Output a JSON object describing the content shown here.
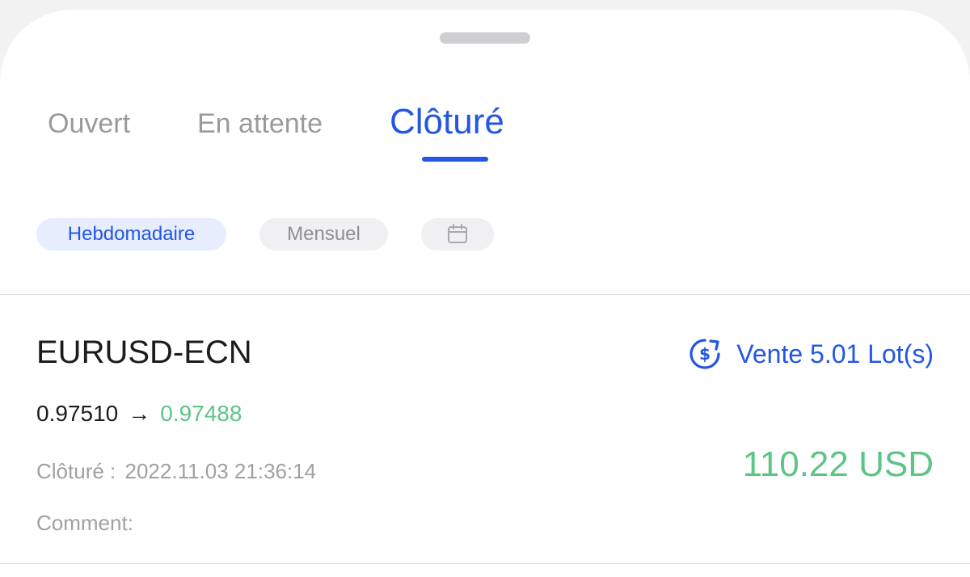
{
  "tabs": {
    "open": "Ouvert",
    "pending": "En attente",
    "closed": "Clôturé"
  },
  "filters": {
    "weekly": "Hebdomadaire",
    "monthly": "Mensuel",
    "calendar_icon": "calendar-icon"
  },
  "trade": {
    "symbol": "EURUSD-ECN",
    "order_icon": "currency-exchange-icon",
    "order_type": "Vente 5.01 Lot(s)",
    "open_price": "0.97510",
    "arrow": "→",
    "close_price": "0.97488",
    "profit": "110.22 USD",
    "closed_label": "Clôturé :",
    "closed_time": "2022.11.03 21:36:14",
    "comment_label": "Comment:"
  },
  "colors": {
    "accent": "#2356e3",
    "profit": "#5cc586",
    "muted": "#9a9a9e"
  }
}
